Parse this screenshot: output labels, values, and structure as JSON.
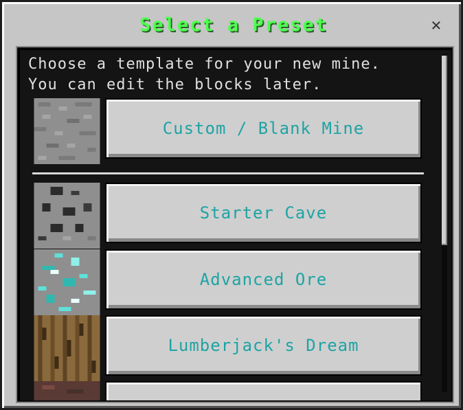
{
  "dialog": {
    "title": "Select a Preset",
    "close_label": "×"
  },
  "description": {
    "line1": "Choose a template for your new mine.",
    "line2": "You can edit the blocks later."
  },
  "presets": [
    {
      "label": "Custom / Blank Mine",
      "icon": "stone-block-icon"
    },
    {
      "label": "Starter Cave",
      "icon": "coal-ore-block-icon"
    },
    {
      "label": "Advanced Ore",
      "icon": "diamond-ore-block-icon"
    },
    {
      "label": "Lumberjack's Dream",
      "icon": "oak-log-block-icon"
    }
  ],
  "colors": {
    "title": "#4cff4c",
    "button_text": "#1fa3a3",
    "panel_bg": "#141414",
    "dialog_bg": "#c6c6c6"
  }
}
